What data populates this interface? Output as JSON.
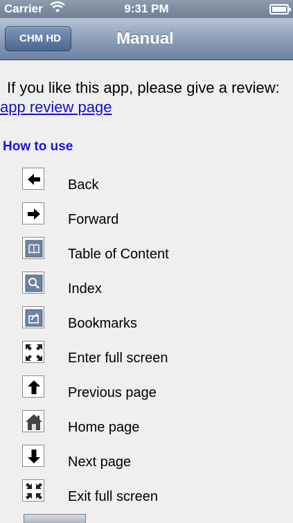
{
  "status_bar": {
    "carrier": "Carrier",
    "time": "9:31 PM"
  },
  "nav": {
    "back_label": "CHM HD",
    "title": "Manual"
  },
  "intro": {
    "text": "If you like this app, please give a review:",
    "link_text": "app review page"
  },
  "section_title": "How to use",
  "items": [
    {
      "icon": "back-arrow-icon",
      "label": "Back"
    },
    {
      "icon": "forward-arrow-icon",
      "label": "Forward"
    },
    {
      "icon": "book-icon",
      "label": "Table of Content"
    },
    {
      "icon": "magnifier-icon",
      "label": "Index"
    },
    {
      "icon": "share-icon",
      "label": "Bookmarks"
    },
    {
      "icon": "expand-icon",
      "label": "Enter full screen"
    },
    {
      "icon": "up-arrow-icon",
      "label": "Previous page"
    },
    {
      "icon": "home-icon",
      "label": "Home page"
    },
    {
      "icon": "down-arrow-icon",
      "label": "Next page"
    },
    {
      "icon": "collapse-icon",
      "label": "Exit full screen"
    }
  ],
  "colors": {
    "link": "#1a0dcc",
    "section_title": "#1a14d6",
    "navbar": "#8ea0b8"
  }
}
